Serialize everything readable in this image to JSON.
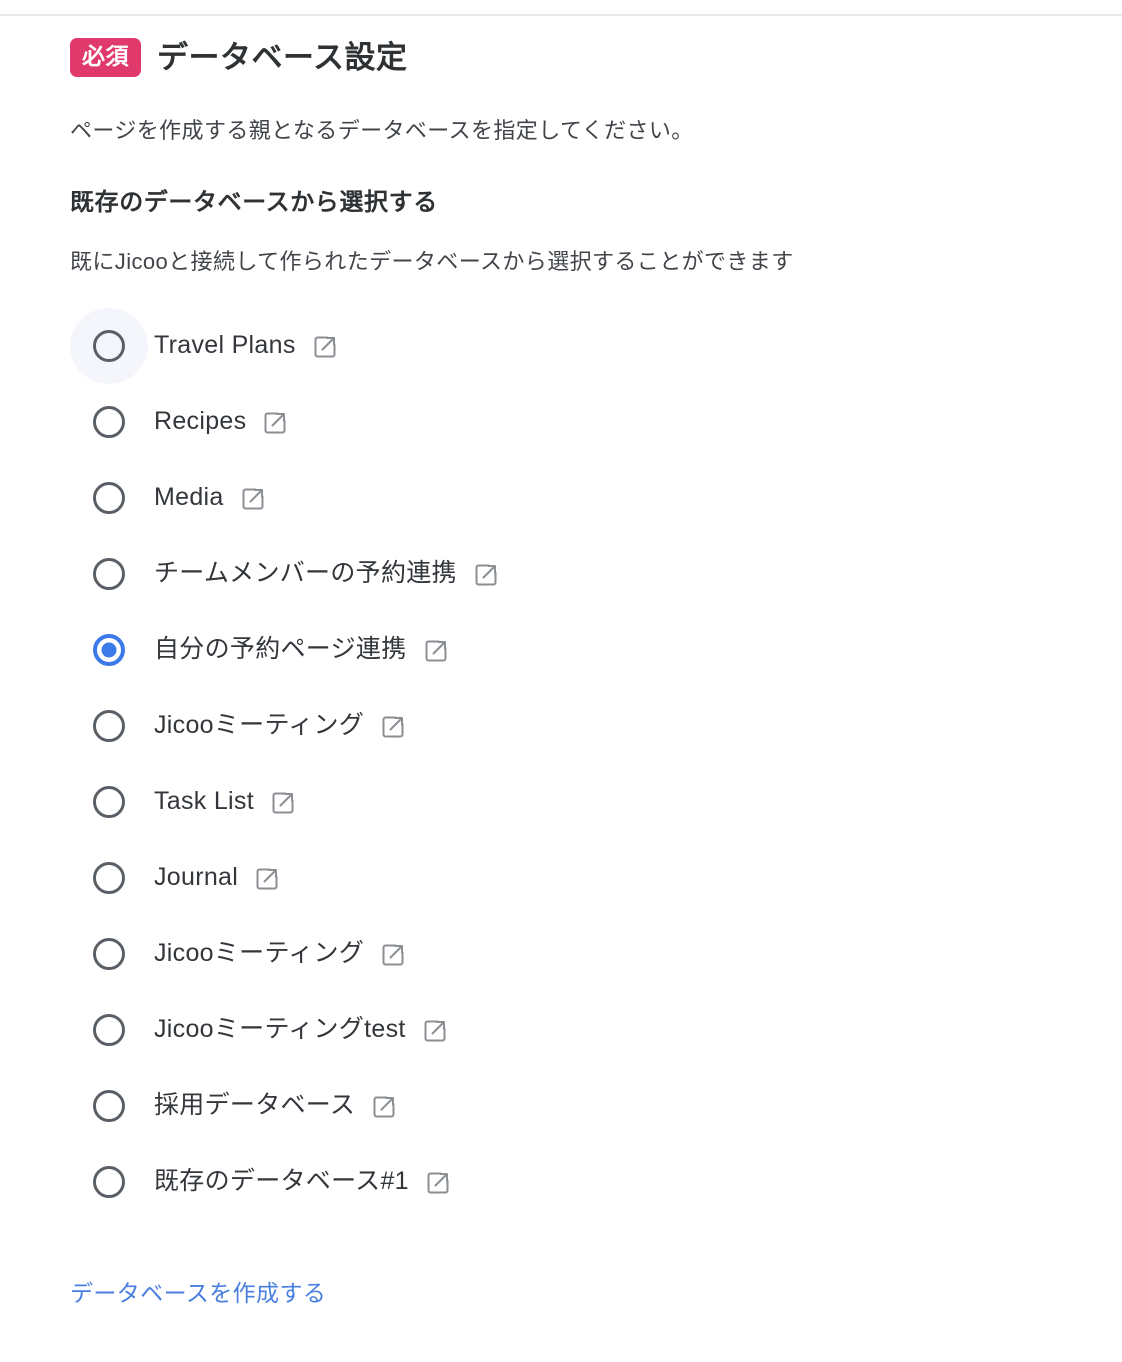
{
  "section": {
    "required_badge": "必須",
    "title": "データベース設定",
    "description": "ページを作成する親となるデータベースを指定してください。"
  },
  "existing": {
    "heading": "既存のデータベースから選択する",
    "description": "既にJicooと接続して作られたデータベースから選択することができます",
    "items": [
      {
        "label": "Travel Plans",
        "selected": false,
        "hovered": true,
        "link_icon": "external-link-icon"
      },
      {
        "label": "Recipes",
        "selected": false,
        "hovered": false,
        "link_icon": "external-link-icon"
      },
      {
        "label": "Media",
        "selected": false,
        "hovered": false,
        "link_icon": "external-link-icon"
      },
      {
        "label": "チームメンバーの予約連携",
        "selected": false,
        "hovered": false,
        "link_icon": "external-link-icon"
      },
      {
        "label": "自分の予約ページ連携",
        "selected": true,
        "hovered": false,
        "link_icon": "external-link-icon"
      },
      {
        "label": "Jicooミーティング",
        "selected": false,
        "hovered": false,
        "link_icon": "external-link-icon"
      },
      {
        "label": "Task List",
        "selected": false,
        "hovered": false,
        "link_icon": "external-link-icon"
      },
      {
        "label": "Journal",
        "selected": false,
        "hovered": false,
        "link_icon": "external-link-icon"
      },
      {
        "label": "Jicooミーティング",
        "selected": false,
        "hovered": false,
        "link_icon": "external-link-icon"
      },
      {
        "label": "Jicooミーティングtest",
        "selected": false,
        "hovered": false,
        "link_icon": "external-link-icon"
      },
      {
        "label": "採用データベース",
        "selected": false,
        "hovered": false,
        "link_icon": "external-link-icon"
      },
      {
        "label": "既存のデータベース#1",
        "selected": false,
        "hovered": false,
        "link_icon": "external-link-icon"
      }
    ]
  },
  "actions": {
    "create_database_link": "データベースを作成する"
  },
  "colors": {
    "badge_background": "#e03a6d",
    "badge_text": "#ffffff",
    "selected_radio": "#3b7ae8",
    "link_text": "#4a7fe0",
    "heading_text": "#2f3234",
    "body_text": "#41454a",
    "radio_border": "#5a5f66",
    "icon_gray": "#8b8f94",
    "hover_background": "#f4f6fc"
  }
}
